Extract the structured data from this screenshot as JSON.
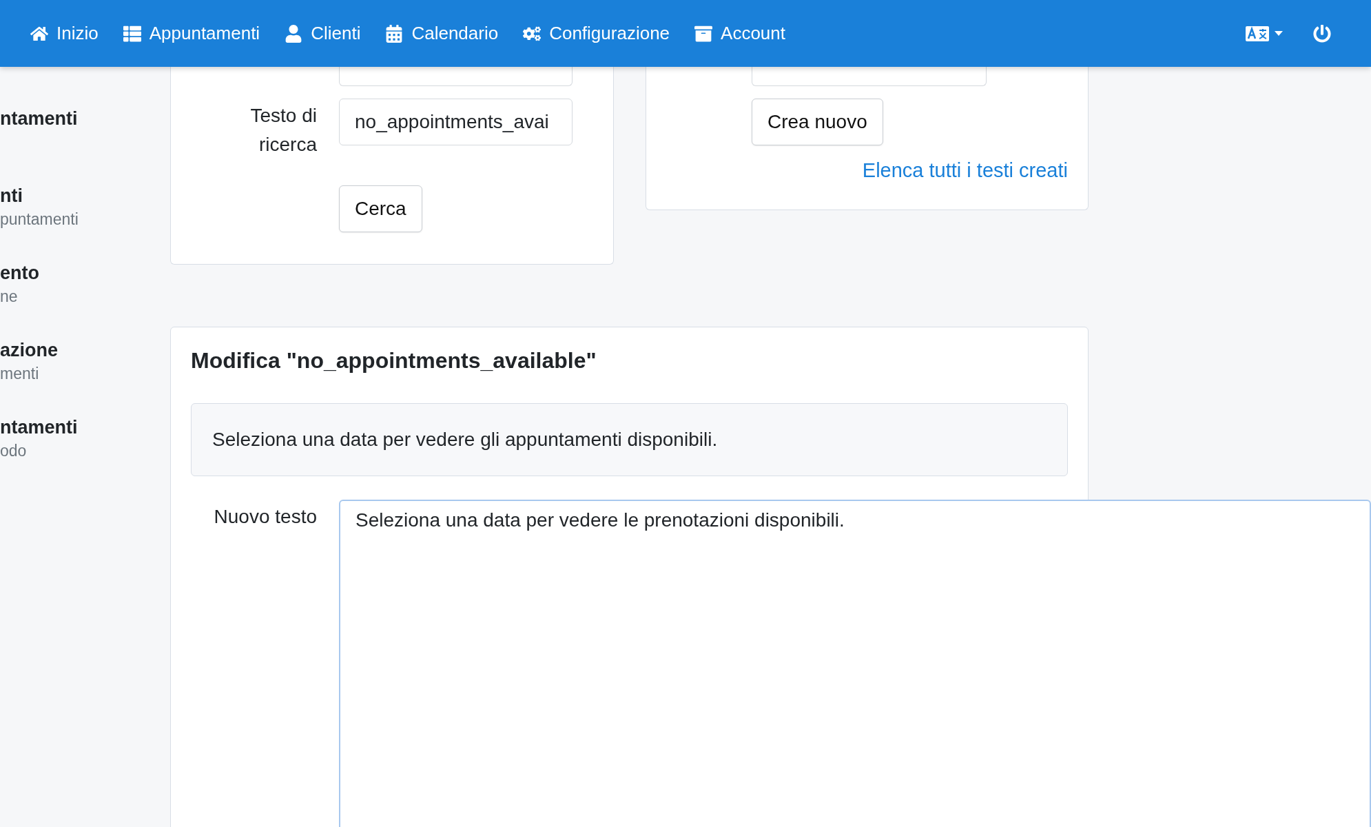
{
  "navbar": {
    "items": [
      {
        "label": "Inizio"
      },
      {
        "label": "Appuntamenti"
      },
      {
        "label": "Clienti"
      },
      {
        "label": "Calendario"
      },
      {
        "label": "Configurazione"
      },
      {
        "label": "Account"
      }
    ]
  },
  "sidebar": {
    "items": [
      {
        "title": "ntamenti"
      },
      {
        "title": "nti",
        "subtitle": "puntamenti"
      },
      {
        "title": "ento",
        "subtitle": "ne"
      },
      {
        "title": "azione",
        "subtitle": "menti"
      },
      {
        "title": "ntamenti",
        "subtitle": "odo"
      }
    ]
  },
  "search_card": {
    "label": "Testo di ricerca",
    "value": "no_appointments_avai",
    "button": "Cerca"
  },
  "create_card": {
    "button": "Crea nuovo",
    "link": "Elenca tutti i testi creati"
  },
  "edit_card": {
    "title": "Modifica \"no_appointments_available\"",
    "original_text": "Seleziona una data per vedere gli appuntamenti disponibili.",
    "label": "Nuovo testo",
    "value": "Seleziona una data per vedere le prenotazioni disponibili."
  }
}
